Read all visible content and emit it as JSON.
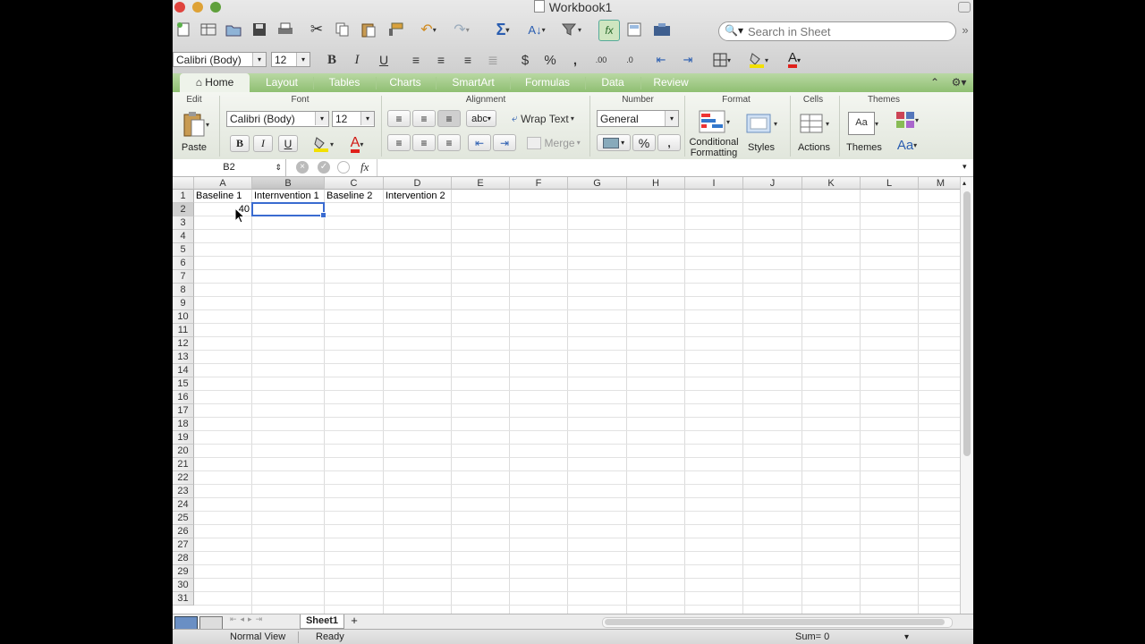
{
  "window": {
    "title": "Workbook1"
  },
  "search": {
    "placeholder": "Search in Sheet"
  },
  "format_bar": {
    "font": "Calibri (Body)",
    "size": "12",
    "bold": "B",
    "italic": "I",
    "underline": "U"
  },
  "tabs": [
    {
      "label": "Home",
      "active": true
    },
    {
      "label": "Layout"
    },
    {
      "label": "Tables"
    },
    {
      "label": "Charts"
    },
    {
      "label": "SmartArt"
    },
    {
      "label": "Formulas"
    },
    {
      "label": "Data"
    },
    {
      "label": "Review"
    }
  ],
  "ribbon": {
    "groups": {
      "edit": "Edit",
      "font": "Font",
      "alignment": "Alignment",
      "number": "Number",
      "format": "Format",
      "cells": "Cells",
      "themes": "Themes"
    },
    "paste": "Paste",
    "font": "Calibri (Body)",
    "size": "12",
    "bold": "B",
    "italic": "I",
    "underline": "U",
    "font_color_letter": "A",
    "abc": "abc",
    "wrap_text": "Wrap Text",
    "merge": "Merge",
    "number_format": "General",
    "percent": "%",
    "comma": ",",
    "conditional_formatting": [
      "Conditional",
      "Formatting"
    ],
    "styles": "Styles",
    "actions": "Actions",
    "themes": "Themes",
    "theme_fonts": "Aa",
    "theme_preview": "Aa"
  },
  "formula_bar": {
    "name_box": "B2",
    "fx": "fx",
    "value": ""
  },
  "grid": {
    "columns": [
      "A",
      "B",
      "C",
      "D",
      "E",
      "F",
      "G",
      "H",
      "I",
      "J",
      "K",
      "L",
      "M"
    ],
    "selected_column": "B",
    "rows": [
      "1",
      "2",
      "3",
      "4",
      "5",
      "6",
      "7",
      "8",
      "9",
      "10",
      "11",
      "12",
      "13",
      "14",
      "15",
      "16",
      "17",
      "18",
      "19",
      "20",
      "21",
      "22",
      "23",
      "24",
      "25",
      "26",
      "27",
      "28",
      "29",
      "30",
      "31"
    ],
    "selected_row": "2",
    "active_cell": "B2",
    "cells": {
      "A1": "Baseline 1",
      "B1": "Internvention 1",
      "C1": "Baseline 2",
      "D1": "Intervention 2",
      "A2": "40"
    }
  },
  "sheet_tabs": [
    {
      "label": "Sheet1",
      "active": true
    }
  ],
  "status": {
    "view": "Normal View",
    "state": "Ready",
    "sum": "Sum= 0"
  },
  "colors": {
    "ribbon_tab": "#9bc77f",
    "selection": "#3a6bd0"
  }
}
